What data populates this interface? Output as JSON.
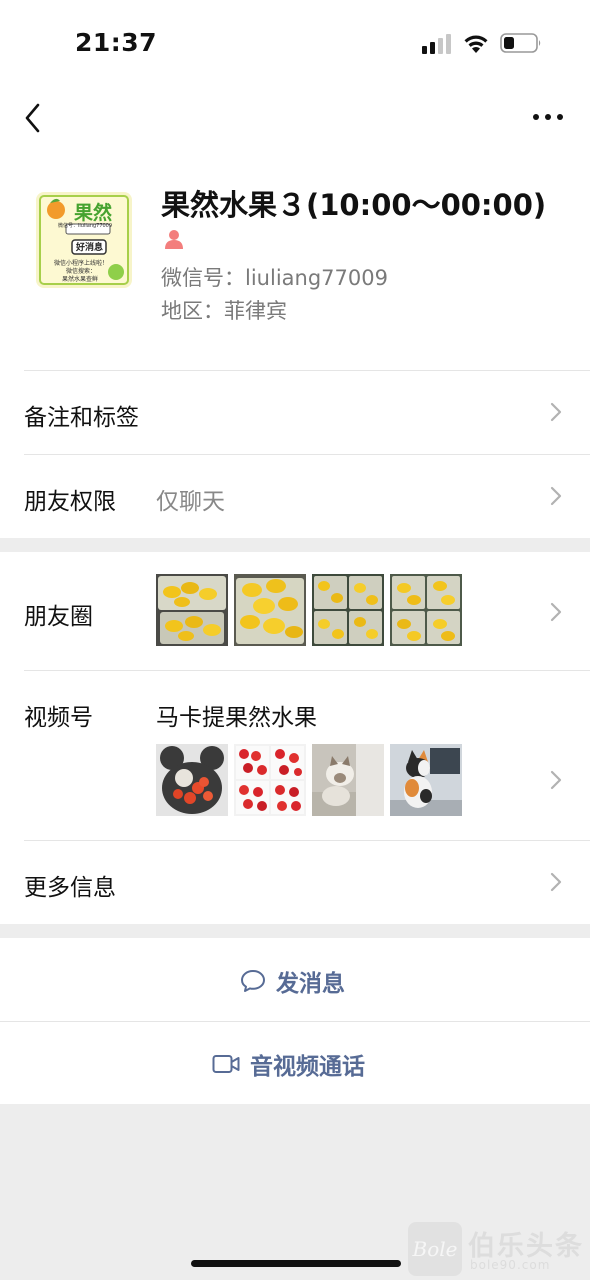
{
  "status_bar": {
    "time": "21:37"
  },
  "profile": {
    "name": "果然水果３(10:00～00:00)",
    "wechat_id": "微信号：liuliang77009",
    "region": "地区：菲律宾",
    "avatar": {
      "brand": "果然",
      "id_line": "微信号：liuliang77009",
      "badge": "好消息",
      "line1": "微信小程序上线啦！",
      "line2": "微信搜索：",
      "line3": "果然水果查鲜"
    }
  },
  "rows": {
    "remarks": {
      "label": "备注和标签"
    },
    "permissions": {
      "label": "朋友权限",
      "value": "仅聊天"
    },
    "moments": {
      "label": "朋友圈"
    },
    "channels": {
      "label": "视频号",
      "value": "马卡提果然水果"
    },
    "more_info": {
      "label": "更多信息"
    }
  },
  "actions": {
    "message": "发消息",
    "call": "音视频通话"
  },
  "watermark": {
    "logo": "Bole",
    "name": "伯乐头条",
    "url": "bole90.com"
  },
  "colors": {
    "link": "#576b95",
    "background": "#ededed",
    "gender": "#f37e7d"
  }
}
